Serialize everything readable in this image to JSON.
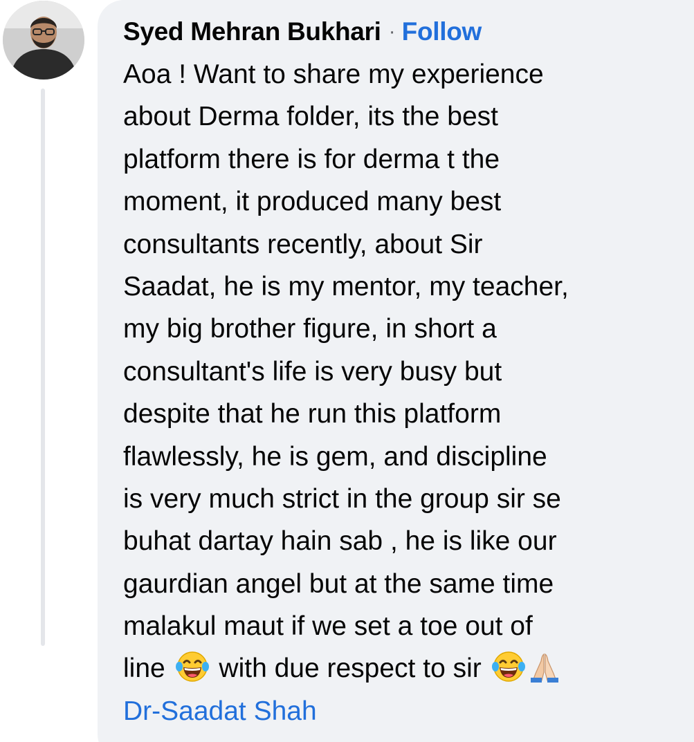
{
  "comment": {
    "author": "Syed Mehran Bukhari",
    "separator": "·",
    "follow_label": "Follow",
    "lines": [
      "Aoa ! Want to share my experience",
      "about Derma folder, its the best",
      "platform there is for derma t the",
      "moment, it produced many best",
      "consultants recently, about Sir",
      "Saadat, he is my mentor, my teacher,",
      "my big brother figure, in short a",
      "consultant's life is very busy but",
      "despite that he run this platform",
      "flawlessly, he is gem, and discipline",
      "is very much strict in the group sir se",
      "buhat dartay hain sab , he is like our",
      "gaurdian angel but at the same time",
      "malakul maut if we set a toe out of"
    ],
    "last_line": {
      "before_emoji": "line",
      "middle": "with due respect to sir",
      "emojis": [
        "tears-of-joy-emoji",
        "tears-of-joy-emoji",
        "folded-hands-emoji"
      ]
    },
    "tagged_user": "Dr-Saadat Shah"
  },
  "colors": {
    "bubble_bg": "#f0f2f5",
    "text": "#050505",
    "link": "#216fdb",
    "muted": "#65676b",
    "thread_line": "#e4e6ea"
  }
}
